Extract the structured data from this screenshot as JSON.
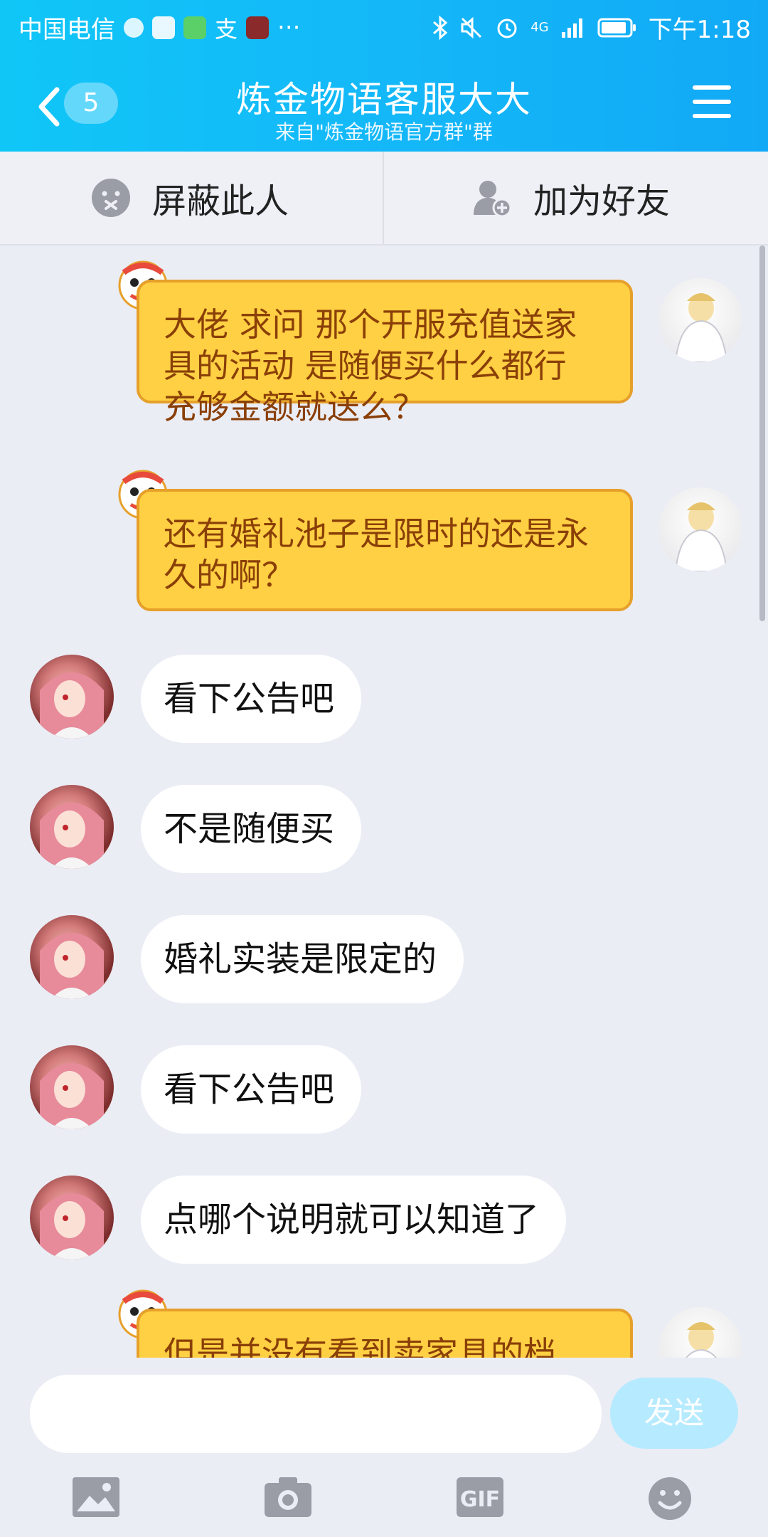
{
  "status_bar": {
    "carrier": "中国电信",
    "dots": "···",
    "network": "4G",
    "time": "下午1:18"
  },
  "header": {
    "back_count": "5",
    "title": "炼金物语客服大大",
    "subtitle": "来自\"炼金物语官方群\"群",
    "colors": {
      "start": "#10c6f7",
      "end": "#11a9f6"
    }
  },
  "actions": {
    "block_label": "屏蔽此人",
    "add_friend_label": "加为好友"
  },
  "messages": [
    {
      "side": "me",
      "text": "大佬 求问 那个开服充值送家具的活动 是随便买什么都行 充够金额就送么？"
    },
    {
      "side": "me",
      "text": "还有婚礼池子是限时的还是永久的啊？"
    },
    {
      "side": "other",
      "text": "看下公告吧"
    },
    {
      "side": "other",
      "text": "不是随便买"
    },
    {
      "side": "other",
      "text": "婚礼实装是限定的"
    },
    {
      "side": "other",
      "text": "看下公告吧"
    },
    {
      "side": "other",
      "text": "点哪个说明就可以知道了"
    },
    {
      "side": "me",
      "text": "但是并没有看到卖家具的档"
    }
  ],
  "input": {
    "placeholder": "",
    "send_label": "发送"
  },
  "toolbar": {
    "icons": [
      "image-icon",
      "camera-icon",
      "gif-icon",
      "emoji-icon"
    ]
  }
}
